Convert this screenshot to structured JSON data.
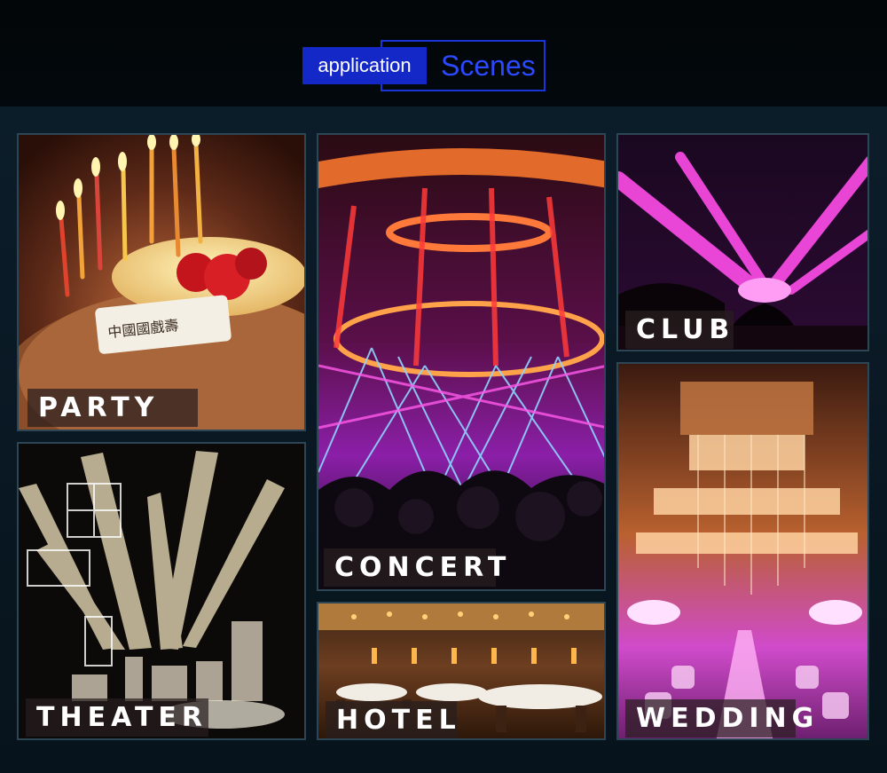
{
  "header": {
    "badge_label": "application",
    "title": "Scenes"
  },
  "tiles": {
    "party": {
      "label": "PARTY"
    },
    "concert": {
      "label": "CONCERT"
    },
    "club": {
      "label": "CLUB"
    },
    "theater": {
      "label": "THEATER"
    },
    "hotel": {
      "label": "HOTEL"
    },
    "wedding": {
      "label": "WEDDING"
    }
  },
  "colors": {
    "accent": "#1428c8",
    "accent_outline": "#2b49ff",
    "background": "#0a1a26"
  }
}
